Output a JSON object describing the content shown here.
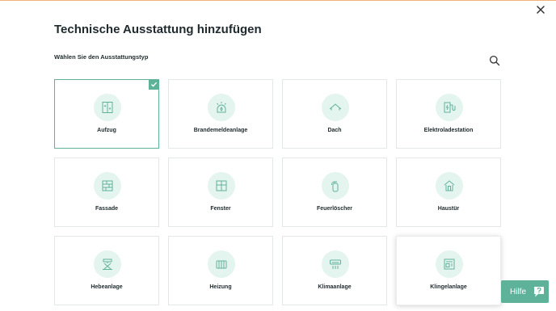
{
  "dialog": {
    "title": "Technische Ausstattung hinzufügen",
    "subtitle": "Wählen Sie den Ausstattungstyp",
    "close_icon": "close-icon",
    "search_icon": "search-icon"
  },
  "colors": {
    "accent": "#5fb29a",
    "icon_background": "#e4f4ef",
    "border": "#e3e7e8",
    "top_accent": "#f1b27a"
  },
  "equipment_types": [
    {
      "label": "Aufzug",
      "icon": "elevator-icon",
      "selected": true
    },
    {
      "label": "Brandemeldeanlage",
      "icon": "fire-alarm-icon",
      "selected": false
    },
    {
      "label": "Dach",
      "icon": "roof-icon",
      "selected": false
    },
    {
      "label": "Elektroladestation",
      "icon": "ev-charging-icon",
      "selected": false
    },
    {
      "label": "Fassade",
      "icon": "facade-icon",
      "selected": false
    },
    {
      "label": "Fenster",
      "icon": "window-icon",
      "selected": false
    },
    {
      "label": "Feuerlöscher",
      "icon": "fire-extinguisher-icon",
      "selected": false
    },
    {
      "label": "Haustür",
      "icon": "front-door-icon",
      "selected": false
    },
    {
      "label": "Hebeanlage",
      "icon": "lifting-system-icon",
      "selected": false
    },
    {
      "label": "Heizung",
      "icon": "heating-icon",
      "selected": false
    },
    {
      "label": "Klimaanlage",
      "icon": "air-conditioner-icon",
      "selected": false
    },
    {
      "label": "Klingelanlage",
      "icon": "doorbell-icon",
      "selected": false
    }
  ],
  "help": {
    "label": "Hilfe",
    "icon": "help-chat-icon"
  }
}
